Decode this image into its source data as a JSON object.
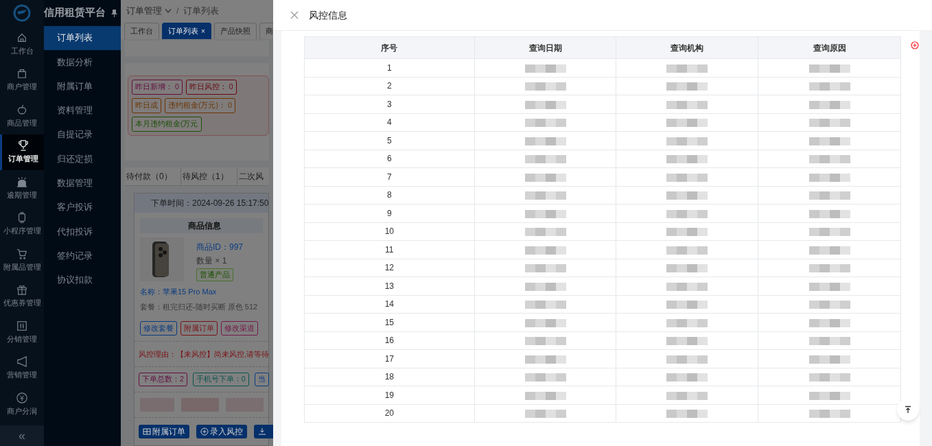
{
  "app": {
    "title": "信用租赁平台"
  },
  "icon_nav": [
    {
      "label": "工作台",
      "selected": false
    },
    {
      "label": "商户管理",
      "selected": false
    },
    {
      "label": "商品管理",
      "selected": false
    },
    {
      "label": "订单管理",
      "selected": true
    },
    {
      "label": "逾期管理",
      "selected": false
    },
    {
      "label": "小程序管理",
      "selected": false
    },
    {
      "label": "附属品管理",
      "selected": false
    },
    {
      "label": "优惠券管理",
      "selected": false
    },
    {
      "label": "分销管理",
      "selected": false
    },
    {
      "label": "营销管理",
      "selected": false
    },
    {
      "label": "商户分润",
      "selected": false
    }
  ],
  "collapse": "«",
  "sub_nav": [
    {
      "label": "订单列表",
      "selected": true
    },
    {
      "label": "数据分析",
      "selected": false
    },
    {
      "label": "附属订单",
      "selected": false
    },
    {
      "label": "资料管理",
      "selected": false
    },
    {
      "label": "自提记录",
      "selected": false
    },
    {
      "label": "归还定损",
      "selected": false
    },
    {
      "label": "数据管理",
      "selected": false
    },
    {
      "label": "客户投诉",
      "selected": false
    },
    {
      "label": "代扣投诉",
      "selected": false
    },
    {
      "label": "签约记录",
      "selected": false
    },
    {
      "label": "协议扣款",
      "selected": false
    }
  ],
  "breadcrumb": [
    "订单管理",
    "/",
    "订单列表"
  ],
  "page_tabs": [
    {
      "label": "工作台",
      "selected": false
    },
    {
      "label": "订单列表",
      "selected": true,
      "close": "×"
    },
    {
      "label": "产品快照",
      "selected": false
    },
    {
      "label": "商",
      "selected": false
    }
  ],
  "stats": [
    {
      "text": "昨日新增： 0",
      "color": "#620e40"
    },
    {
      "text": "昨日风控： 0",
      "color": "#680a11"
    },
    {
      "text": "昨日成",
      "color": "#6a3604"
    },
    {
      "text": "违约租金(万元)： 0",
      "color": "#6a3604"
    },
    {
      "text": "本月违约租金(万元",
      "color": "#1c4f07"
    }
  ],
  "order_tabs": [
    "待付款（0）",
    "待风控（1）",
    "二次风"
  ],
  "order": {
    "time": "下单时间：2024-09-26 15:17:50",
    "goods_header": "商品信息",
    "goods_id": "商品ID：997",
    "quantity": "数量 × 1",
    "tag": "普通产品",
    "name": "名称：苹果15 Pro Max",
    "package": "套餐：租完归还-随时买断 原色 512",
    "actions": [
      {
        "label": "修改套餐",
        "color": "#0b3c80"
      },
      {
        "label": "附属订单",
        "color": "#7b1117"
      },
      {
        "label": "修改渠道",
        "color": "#76184b"
      }
    ],
    "risk_reason": "风控理由：【未风控】尚未风控,请等待",
    "counts": [
      {
        "text": "下单总数：2",
        "color": "#620e40"
      },
      {
        "text": "手机号下单：0",
        "color": "#0a544f"
      },
      {
        "text": "当",
        "color": "#0b3c80"
      }
    ],
    "buttons": [
      "附属订单",
      "录入风控"
    ]
  },
  "drawer": {
    "title": "风控信息",
    "columns": [
      "序号",
      "查询日期",
      "查询机构",
      "查询原因"
    ],
    "rows": [
      "1",
      "2",
      "3",
      "4",
      "5",
      "6",
      "7",
      "8",
      "9",
      "10",
      "11",
      "12",
      "13",
      "14",
      "15",
      "16",
      "17",
      "18",
      "19",
      "20"
    ]
  }
}
